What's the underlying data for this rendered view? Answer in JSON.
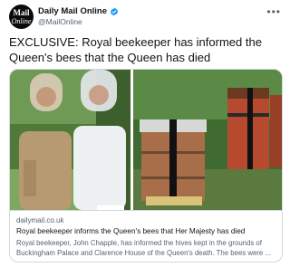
{
  "account": {
    "avatar_line1": "Mail",
    "avatar_line2": "Online",
    "display_name": "Daily Mail Online",
    "handle": "@MailOnline",
    "verified_icon": "verified-badge-icon",
    "verified_color": "#1d9bf0"
  },
  "tweet": {
    "text": "EXCLUSIVE: Royal beekeeper has informed the Queen's bees that the Queen has died",
    "more_icon": "more-options-icon"
  },
  "card": {
    "domain": "dailymail.co.uk",
    "title": "Royal beekeeper informs the Queen's bees that Her Majesty has died",
    "description": "Royal beekeeper, John Chapple, has informed the hives kept in the grounds of Buckingham Palace and Clarence House of the Queen's death. The bees were ..."
  },
  "colors": {
    "text_primary": "#0f1419",
    "text_secondary": "#536471",
    "border": "#cfd9de",
    "black_ribbon": "#111111"
  }
}
